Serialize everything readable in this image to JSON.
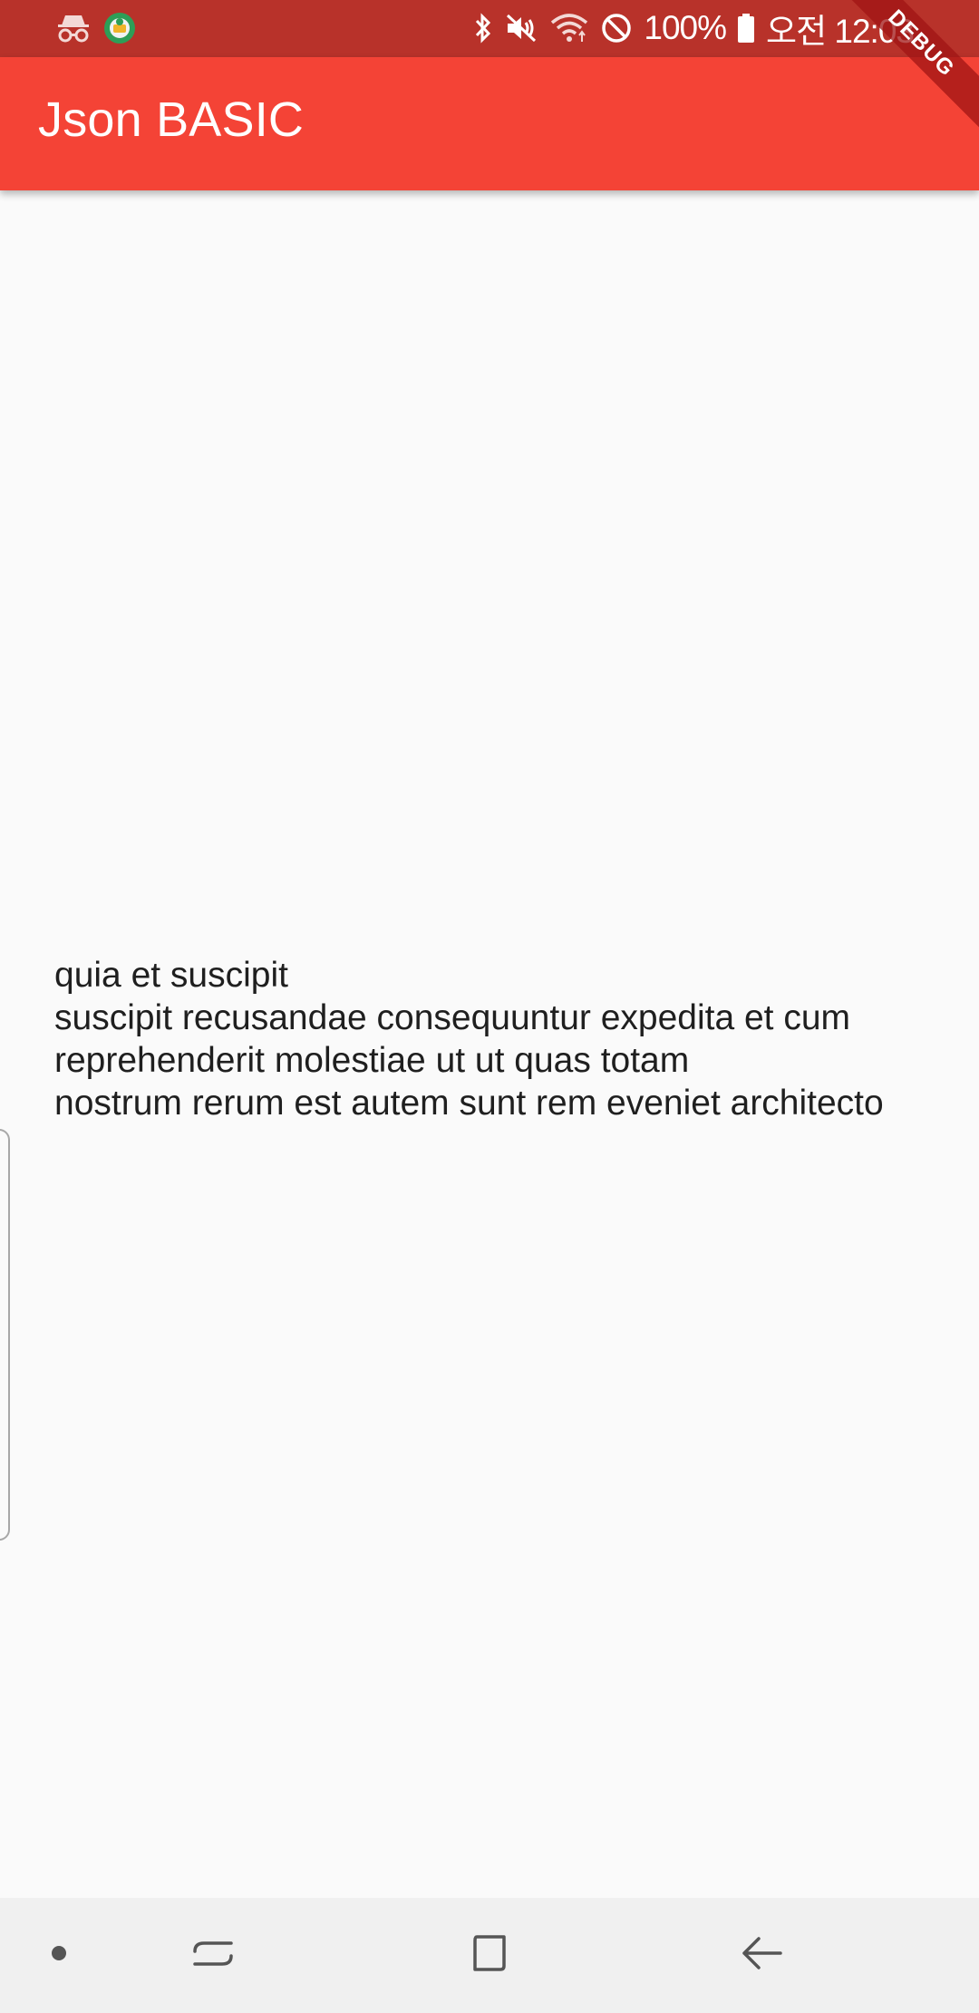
{
  "status_bar": {
    "battery_text": "100%",
    "time_text": "오전 12:03",
    "icons": [
      "incognito-icon",
      "app-badge-icon",
      "bluetooth-icon",
      "mute-icon",
      "wifi-icon",
      "blocked-icon",
      "battery-icon"
    ]
  },
  "app_bar": {
    "title": "Json BASIC",
    "debug_banner": "DEBUG",
    "color": "#f44336"
  },
  "content": {
    "lines": [
      "quia et suscipit",
      "suscipit recusandae consequuntur expedita et cum",
      "reprehenderit molestiae ut ut quas totam",
      "nostrum rerum est autem sunt rem eveniet architecto"
    ]
  },
  "nav_bar": {
    "icons": [
      "dot-icon",
      "recents-icon",
      "home-icon",
      "back-icon"
    ]
  }
}
